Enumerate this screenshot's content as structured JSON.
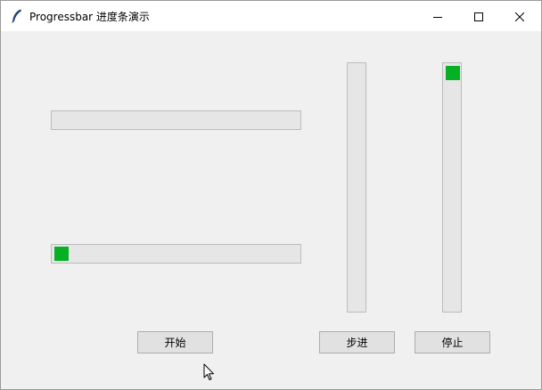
{
  "window": {
    "title": "Progressbar 进度条演示",
    "app_icon": "feather-icon",
    "controls": {
      "minimize": "minimize-icon",
      "maximize": "maximize-icon",
      "close": "close-icon"
    }
  },
  "progressbars": [
    {
      "name": "horizontal-progressbar-top",
      "orientation": "horizontal",
      "mode": "determinate",
      "value": 0
    },
    {
      "name": "horizontal-progressbar-bottom",
      "orientation": "horizontal",
      "mode": "indeterminate"
    },
    {
      "name": "vertical-progressbar-left",
      "orientation": "vertical",
      "mode": "determinate",
      "value": 0
    },
    {
      "name": "vertical-progressbar-right",
      "orientation": "vertical",
      "mode": "indeterminate"
    }
  ],
  "buttons": {
    "start": "开始",
    "step": "步进",
    "stop": "停止"
  },
  "colors": {
    "progress_fill": "#06b025",
    "trough": "#e6e6e6",
    "window_bg": "#f0f0f0"
  }
}
